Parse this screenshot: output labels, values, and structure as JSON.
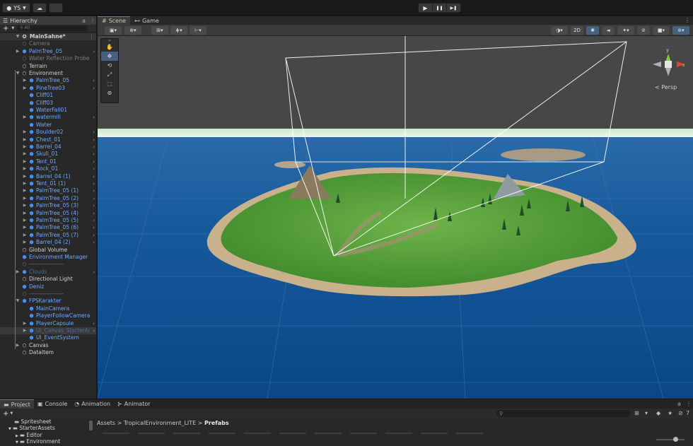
{
  "toolbar": {
    "account_label": "YS",
    "account_caret": "▼",
    "cloud_icon": "cloud-icon",
    "play_icon": "▶",
    "pause_icon": "❚❚",
    "step_icon": "▶❚"
  },
  "hierarchy": {
    "tab_label": "Hierarchy",
    "add_label": "+",
    "search_placeholder": "All",
    "scene_name": "MainSahne*",
    "rows": [
      {
        "label": "Camera",
        "indent": 2,
        "type": "dim",
        "arrow": ""
      },
      {
        "label": "PalmTree_05",
        "indent": 2,
        "type": "prefab",
        "arrow": "▶"
      },
      {
        "label": "Water Reflection Probe",
        "indent": 2,
        "type": "dim",
        "arrow": ""
      },
      {
        "label": "Terrain",
        "indent": 2,
        "type": "norm",
        "arrow": ""
      },
      {
        "label": "Environment",
        "indent": 2,
        "type": "norm",
        "arrow": "▼"
      },
      {
        "label": "PalmTree_05",
        "indent": 3,
        "type": "prefab",
        "arrow": "▶"
      },
      {
        "label": "PineTree03",
        "indent": 3,
        "type": "prefab",
        "arrow": "▶"
      },
      {
        "label": "Cliff01",
        "indent": 3,
        "type": "prefab",
        "arrow": ""
      },
      {
        "label": "Cliff03",
        "indent": 3,
        "type": "prefab",
        "arrow": ""
      },
      {
        "label": "WaterFall01",
        "indent": 3,
        "type": "prefab",
        "arrow": ""
      },
      {
        "label": "watermill",
        "indent": 3,
        "type": "prefab",
        "arrow": "▶"
      },
      {
        "label": "Water",
        "indent": 3,
        "type": "prefab",
        "arrow": ""
      },
      {
        "label": "Boulder02",
        "indent": 3,
        "type": "prefab",
        "arrow": "▶"
      },
      {
        "label": "Chest_01",
        "indent": 3,
        "type": "prefab",
        "arrow": "▶"
      },
      {
        "label": "Barrel_04",
        "indent": 3,
        "type": "prefab",
        "arrow": "▶"
      },
      {
        "label": "Skull_01",
        "indent": 3,
        "type": "prefab",
        "arrow": "▶"
      },
      {
        "label": "Tent_01",
        "indent": 3,
        "type": "prefab",
        "arrow": "▶"
      },
      {
        "label": "Rock_01",
        "indent": 3,
        "type": "prefab",
        "arrow": "▶"
      },
      {
        "label": "Barrel_04 (1)",
        "indent": 3,
        "type": "prefab",
        "arrow": "▶"
      },
      {
        "label": "Tent_01 (1)",
        "indent": 3,
        "type": "prefab",
        "arrow": "▶"
      },
      {
        "label": "PalmTree_05 (1)",
        "indent": 3,
        "type": "prefab",
        "arrow": "▶"
      },
      {
        "label": "PalmTree_05 (2)",
        "indent": 3,
        "type": "prefab",
        "arrow": "▶"
      },
      {
        "label": "PalmTree_05 (3)",
        "indent": 3,
        "type": "prefab",
        "arrow": "▶"
      },
      {
        "label": "PalmTree_05 (4)",
        "indent": 3,
        "type": "prefab",
        "arrow": "▶"
      },
      {
        "label": "PalmTree_05 (5)",
        "indent": 3,
        "type": "prefab",
        "arrow": "▶"
      },
      {
        "label": "PalmTree_05 (6)",
        "indent": 3,
        "type": "prefab",
        "arrow": "▶"
      },
      {
        "label": "PalmTree_05 (7)",
        "indent": 3,
        "type": "prefab",
        "arrow": "▶"
      },
      {
        "label": "Barrel_04 (2)",
        "indent": 3,
        "type": "prefab",
        "arrow": "▶"
      },
      {
        "label": "Global Volume",
        "indent": 2,
        "type": "norm",
        "arrow": ""
      },
      {
        "label": "Environment Manager",
        "indent": 2,
        "type": "prefab",
        "arrow": ""
      },
      {
        "label": "------------------",
        "indent": 2,
        "type": "dim",
        "arrow": ""
      },
      {
        "label": "Clouds",
        "indent": 2,
        "type": "dimblue",
        "arrow": "▶"
      },
      {
        "label": "Directional Light",
        "indent": 2,
        "type": "norm",
        "arrow": ""
      },
      {
        "label": "Deniz",
        "indent": 2,
        "type": "prefab",
        "arrow": ""
      },
      {
        "label": "------------------",
        "indent": 2,
        "type": "dim",
        "arrow": ""
      },
      {
        "label": "FPSKarakter",
        "indent": 2,
        "type": "prefab",
        "arrow": "▼"
      },
      {
        "label": "MainCamera",
        "indent": 3,
        "type": "prefab",
        "arrow": ""
      },
      {
        "label": "PlayerFollowCamera",
        "indent": 3,
        "type": "prefab",
        "arrow": ""
      },
      {
        "label": "PlayerCapsule",
        "indent": 3,
        "type": "prefab",
        "arrow": "▶"
      },
      {
        "label": "UI_Canvas_StarterAssetsInputs_Joysticks",
        "indent": 3,
        "type": "dimblue",
        "arrow": "▶"
      },
      {
        "label": "UI_EventSystem",
        "indent": 3,
        "type": "prefab",
        "arrow": ""
      },
      {
        "label": "Canvas",
        "indent": 2,
        "type": "norm",
        "arrow": "▶"
      },
      {
        "label": "DataItem",
        "indent": 2,
        "type": "norm",
        "arrow": ""
      }
    ]
  },
  "scene": {
    "tab_scene": "Scene",
    "tab_game": "Game",
    "btn_2d": "2D",
    "persp_label": "Persp",
    "axis_y": "y",
    "axis_x": "x"
  },
  "bottom": {
    "tabs": [
      "Project",
      "Console",
      "Animation",
      "Animator"
    ],
    "add_label": "+",
    "search_placeholder": "",
    "tree": [
      {
        "label": "Spritesheet",
        "arrow": ""
      },
      {
        "label": "StarterAssets",
        "arrow": "▼"
      },
      {
        "label": "Editor",
        "arrow": "▶"
      },
      {
        "label": "Environment",
        "arrow": "▼"
      }
    ],
    "breadcrumb": [
      "Assets",
      "TropicalEnvironment_LITE",
      "Prefabs"
    ],
    "count_label": "7"
  }
}
